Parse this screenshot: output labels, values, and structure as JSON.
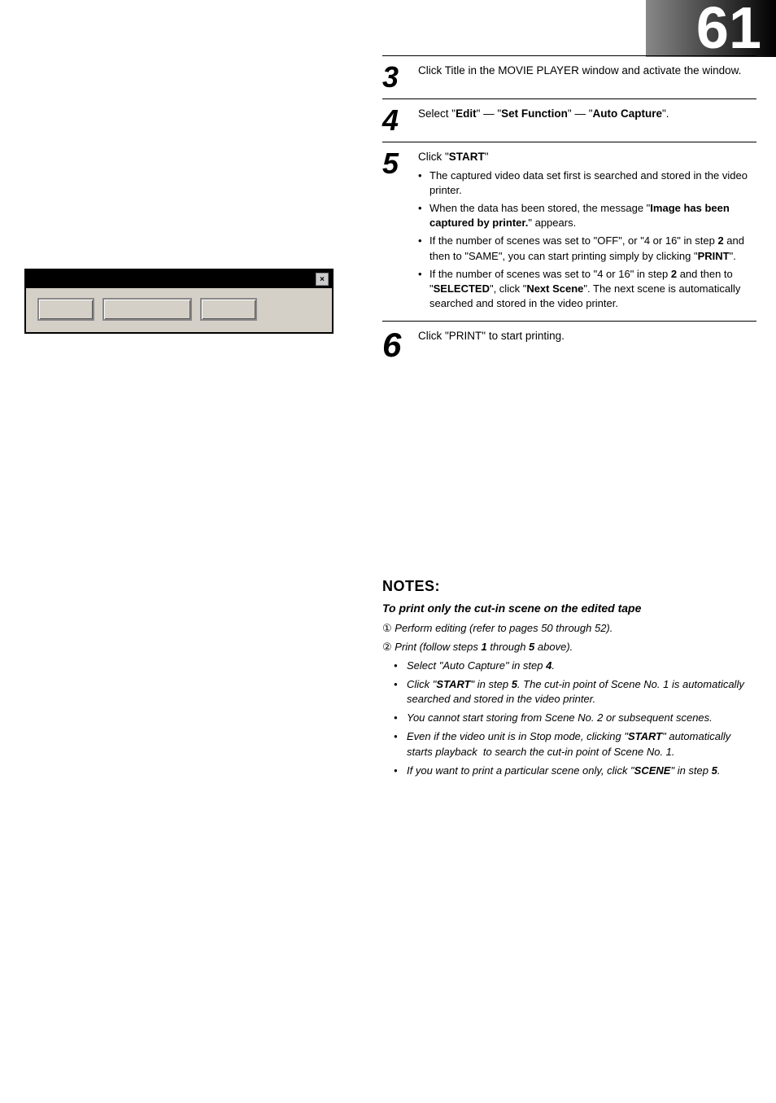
{
  "page": {
    "number": "61"
  },
  "dialog": {
    "close_btn": "×",
    "buttons": [
      "",
      "",
      ""
    ]
  },
  "steps": [
    {
      "number": "3",
      "text": "Click Title in the MOVIE PLAYER window and activate the window."
    },
    {
      "number": "4",
      "text_parts": [
        {
          "type": "normal",
          "text": "Select \""
        },
        {
          "type": "bold",
          "text": "Edit"
        },
        {
          "type": "normal",
          "text": "\" — \""
        },
        {
          "type": "bold",
          "text": "Set Function"
        },
        {
          "type": "normal",
          "text": "\" — \""
        },
        {
          "type": "bold",
          "text": "Auto Capture"
        },
        {
          "type": "normal",
          "text": "\"."
        }
      ]
    },
    {
      "number": "5",
      "title_parts": [
        {
          "type": "normal",
          "text": "Click \""
        },
        {
          "type": "bold",
          "text": "START"
        },
        {
          "type": "normal",
          "text": "\""
        }
      ],
      "bullets": [
        "The captured video data set first is searched and stored in the video printer.",
        "When the data has been stored, the message \"<b>Image has been captured by printer.</b>\" appears.",
        "If the number of scenes was set to \"OFF\", or \"4 or 16\" in step <b>2</b> and then to \"SAME\", you can start printing simply by clicking \"<b>PRINT</b>\".",
        "If the number of scenes was set to \"4 or 16\" in step <b>2</b> and then to \"<b>SELECTED</b>\", click \"<b>Next Scene</b>\". The next scene is automatically searched and stored in the video printer."
      ]
    },
    {
      "number": "6",
      "text": "Click \"PRINT\" to start printing."
    }
  ],
  "notes": {
    "title": "NOTES:",
    "subtitle": "To print only the cut-in scene on the edited tape",
    "items": [
      {
        "num": "①",
        "text": "Perform editing (refer to pages 50 through 52)."
      },
      {
        "num": "②",
        "text": "Print (follow steps ",
        "text2": "1",
        "text3": " through ",
        "text4": "5",
        "text5": " above)."
      }
    ],
    "bullets": [
      "Select \"Auto Capture\" in step <b>4</b>.",
      "Click \"<b>START</b>\" in step <b>5</b>.  The cut-in point of Scene No. 1 is automatically searched and stored in the video printer.",
      "You cannot start storing from Scene No. 2 or subsequent scenes.",
      "Even if the video unit is in Stop mode, clicking \"<b>START</b>\" automatically starts playback  to search the cut-in point of Scene No. 1.",
      "If you want to print a particular scene only, click \"<b>SCENE</b>\" in step <b>5</b>."
    ]
  }
}
